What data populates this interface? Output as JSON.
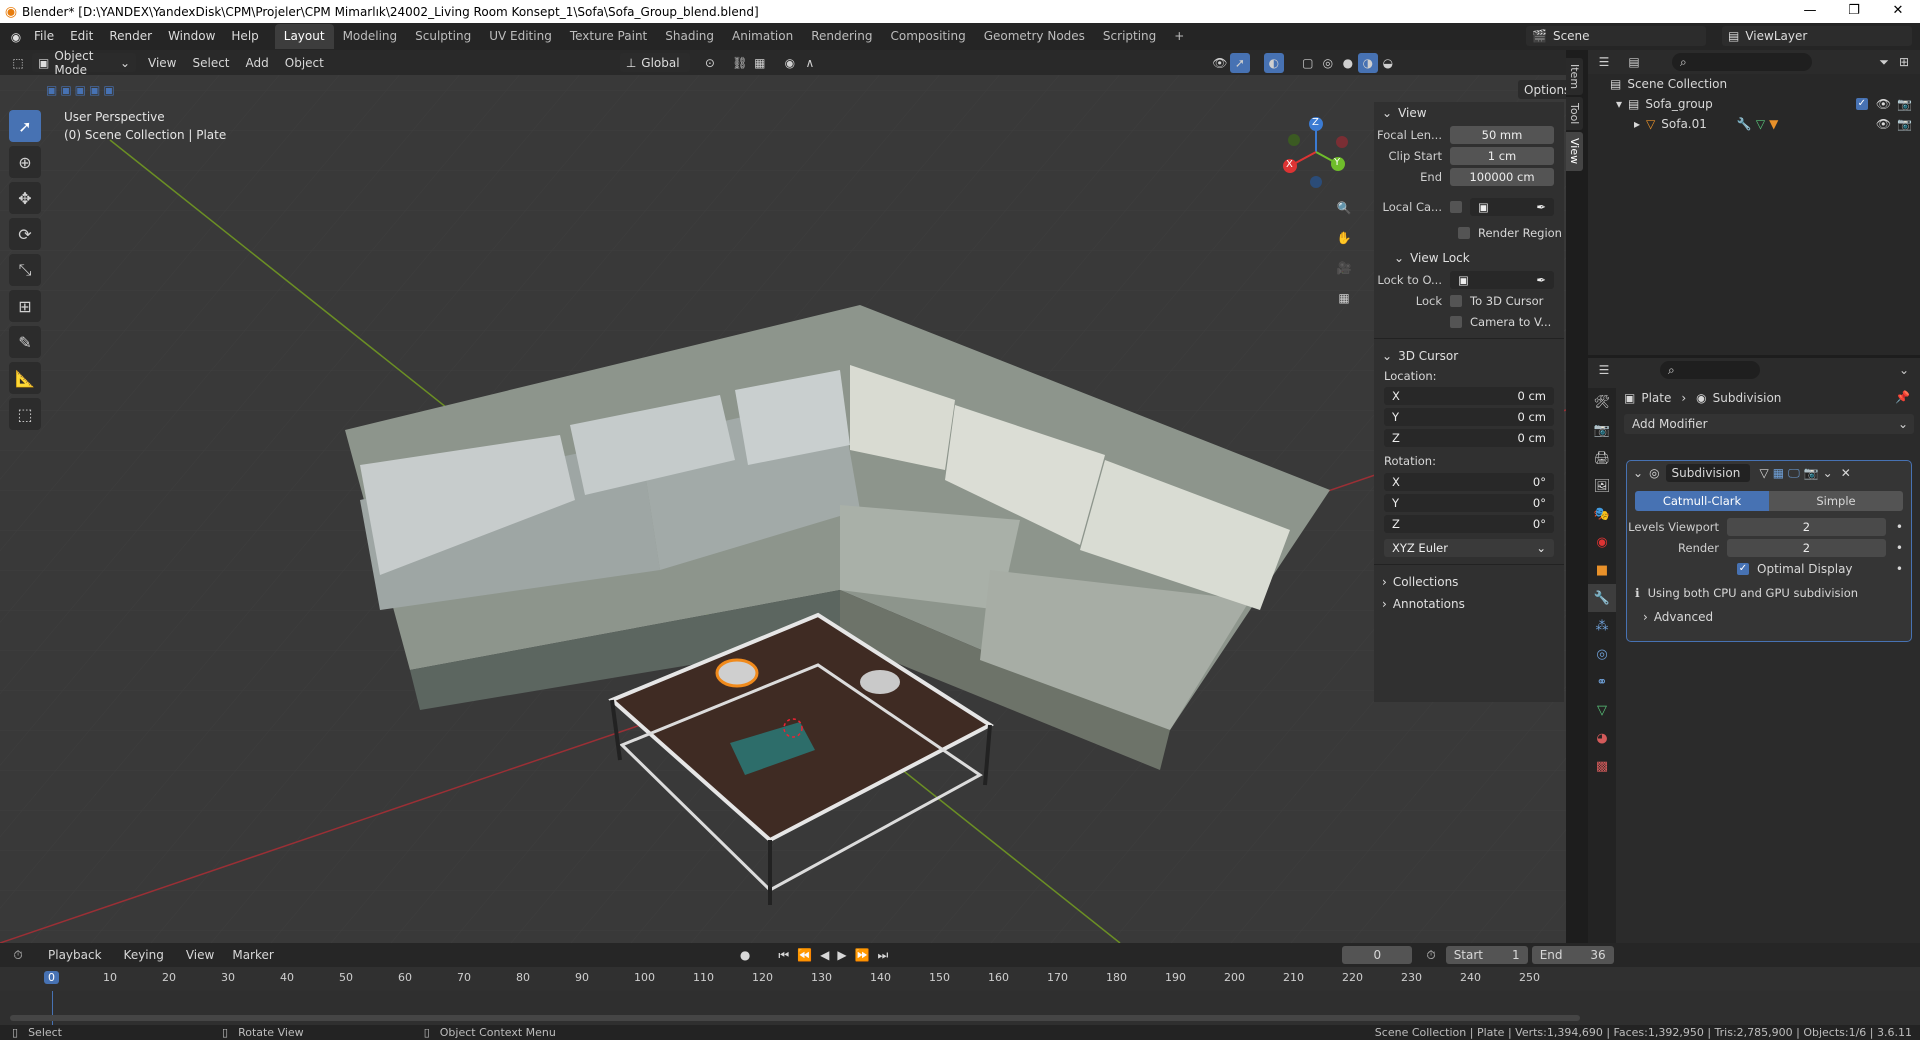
{
  "titlebar": {
    "title": "Blender* [D:\\YANDEX\\YandexDisk\\CPM\\Projeler\\CPM Mimarlık\\24002_Living Room Konsept_1\\Sofa\\Sofa_Group_blend.blend]"
  },
  "menu": [
    "File",
    "Edit",
    "Render",
    "Window",
    "Help"
  ],
  "workspaces": [
    "Layout",
    "Modeling",
    "Sculpting",
    "UV Editing",
    "Texture Paint",
    "Shading",
    "Animation",
    "Rendering",
    "Compositing",
    "Geometry Nodes",
    "Scripting",
    "+"
  ],
  "scene": "Scene",
  "view_layer": "ViewLayer",
  "viewport": {
    "mode": "Object Mode",
    "menus": [
      "View",
      "Select",
      "Add",
      "Object"
    ],
    "orientation": "Global",
    "options": "Options",
    "info_line1": "User Perspective",
    "info_line2": "(0) Scene Collection | Plate",
    "gizmo": {
      "x": "X",
      "y": "Y",
      "z": "Z"
    }
  },
  "npanel": {
    "tabs": [
      "Item",
      "Tool",
      "View"
    ],
    "view_header": "View",
    "focal_label": "Focal Len...",
    "focal_value": "50 mm",
    "clip_start_label": "Clip Start",
    "clip_start_value": "1 cm",
    "clip_end_label": "End",
    "clip_end_value": "100000 cm",
    "local_cam_label": "Local Ca...",
    "render_region": "Render Region",
    "view_lock_header": "View Lock",
    "lock_to_label": "Lock to O...",
    "lock_label": "Lock",
    "to_3d_cursor": "To 3D Cursor",
    "camera_to_view": "Camera to V...",
    "cursor_header": "3D Cursor",
    "location_label": "Location:",
    "loc": [
      {
        "axis": "X",
        "value": "0 cm"
      },
      {
        "axis": "Y",
        "value": "0 cm"
      },
      {
        "axis": "Z",
        "value": "0 cm"
      }
    ],
    "rotation_label": "Rotation:",
    "rot": [
      {
        "axis": "X",
        "value": "0°"
      },
      {
        "axis": "Y",
        "value": "0°"
      },
      {
        "axis": "Z",
        "value": "0°"
      }
    ],
    "rot_mode": "XYZ Euler",
    "collections": "Collections",
    "annotations": "Annotations"
  },
  "outliner": {
    "root": "Scene Collection",
    "group": "Sofa_group",
    "object": "Sofa.01"
  },
  "properties": {
    "breadcrumb_obj": "Plate",
    "breadcrumb_mod": "Subdivision",
    "add_modifier": "Add Modifier",
    "mod_name": "Subdivision",
    "seg_a": "Catmull-Clark",
    "seg_b": "Simple",
    "levels_label": "Levels Viewport",
    "levels_value": "2",
    "render_label": "Render",
    "render_value": "2",
    "optimal": "Optimal Display",
    "info": "Using both CPU and GPU subdivision",
    "advanced": "Advanced"
  },
  "timeline": {
    "menus": [
      "Playback",
      "Keying",
      "View",
      "Marker"
    ],
    "current": "0",
    "start_label": "Start",
    "start": "1",
    "end_label": "End",
    "end": "36",
    "ticks": [
      "0",
      "10",
      "20",
      "30",
      "40",
      "50",
      "60",
      "70",
      "80",
      "90",
      "100",
      "110",
      "120",
      "130",
      "140",
      "150",
      "160",
      "170",
      "180",
      "190",
      "200",
      "210",
      "220",
      "230",
      "240",
      "250"
    ]
  },
  "status": {
    "left1": "Select",
    "left2": "Rotate View",
    "left3": "Object Context Menu",
    "right": "Scene Collection | Plate | Verts:1,394,690 | Faces:1,392,950 | Tris:2,785,900 | Objects:1/6 | 3.6.11"
  }
}
